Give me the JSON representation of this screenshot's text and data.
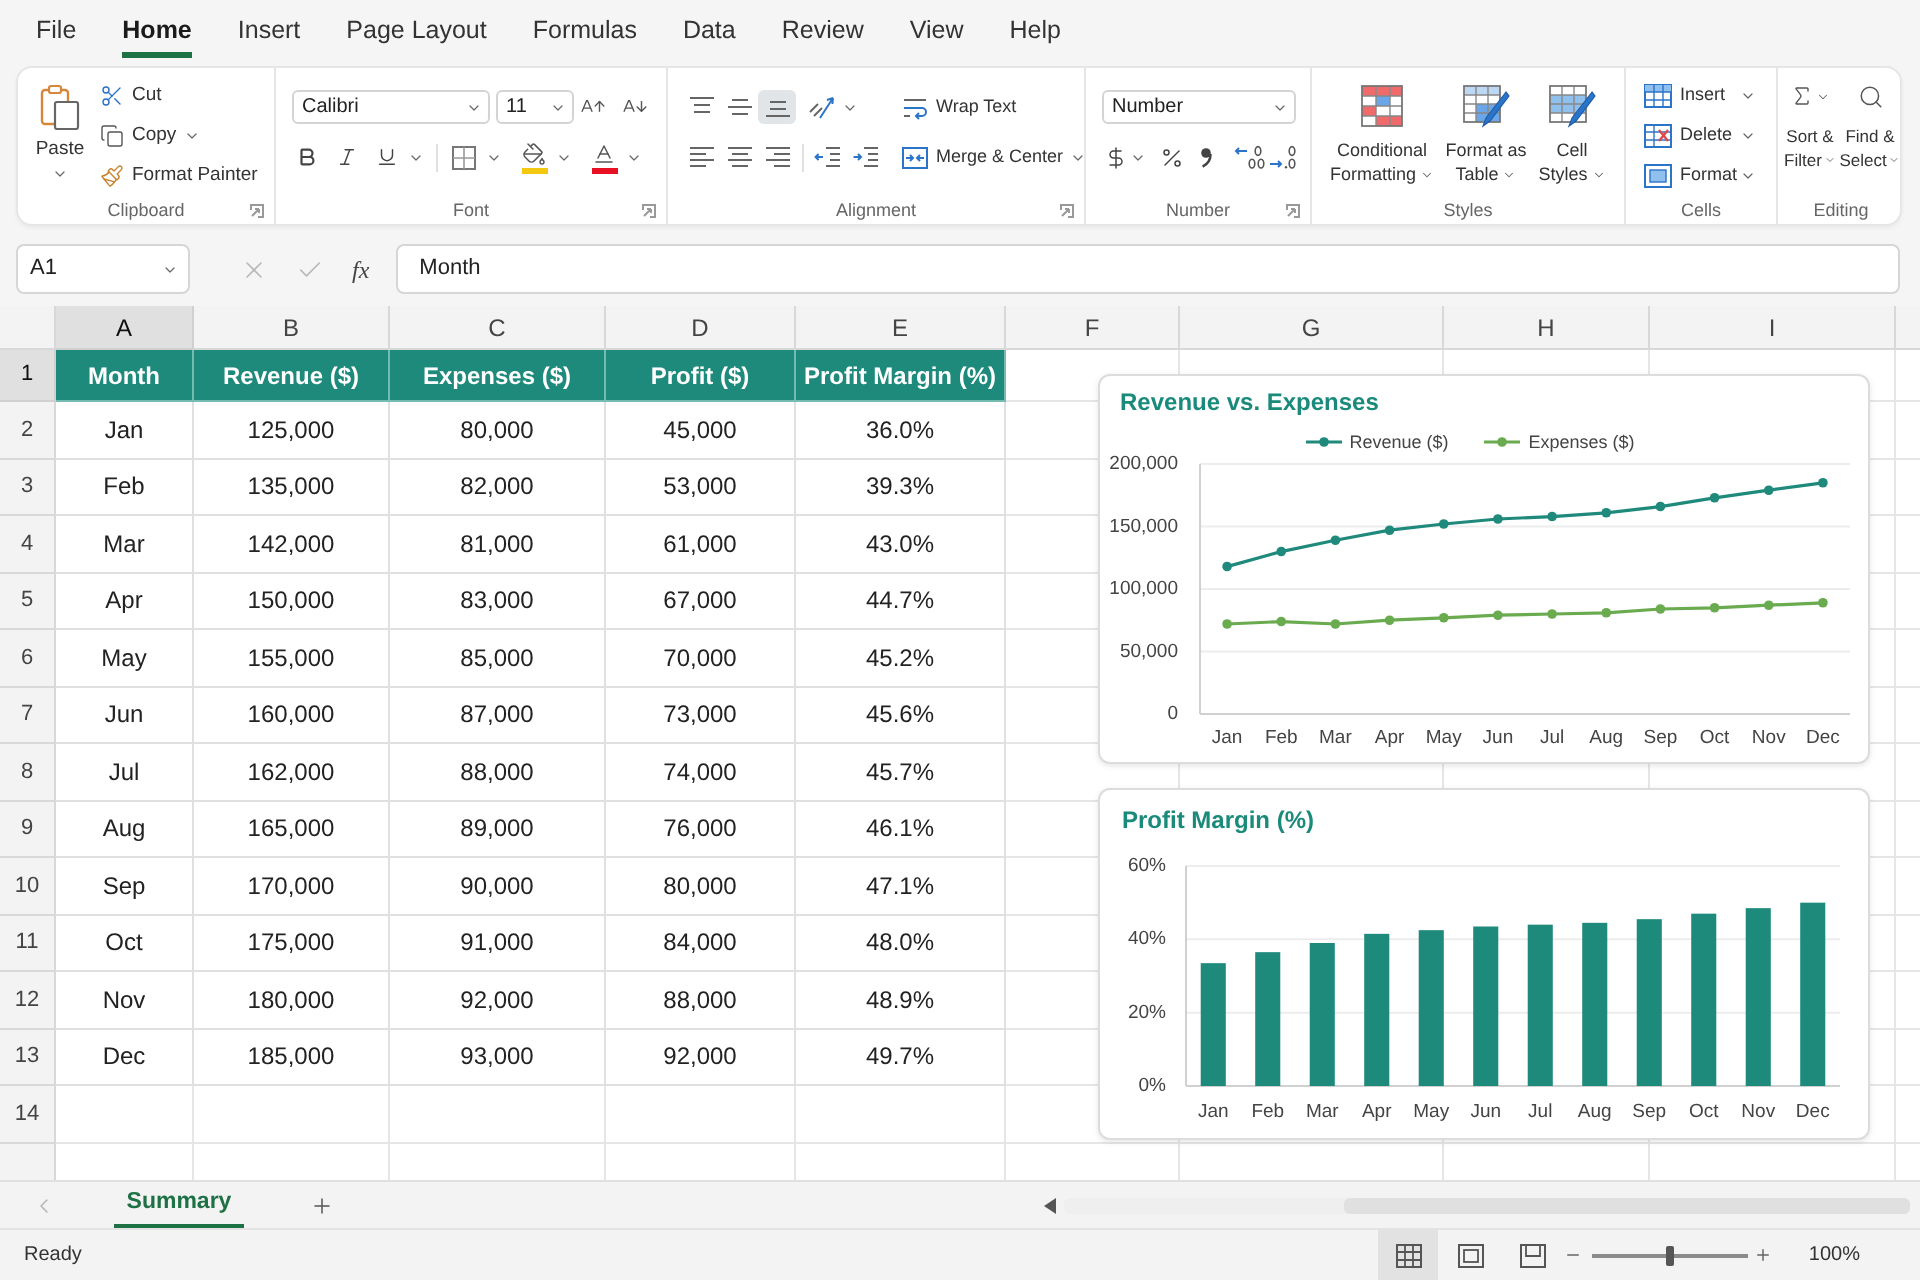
{
  "menu_tabs": [
    {
      "label": "File",
      "selected": false
    },
    {
      "label": "Home",
      "selected": true
    },
    {
      "label": "Insert",
      "selected": false
    },
    {
      "label": "Page Layout",
      "selected": false
    },
    {
      "label": "Formulas",
      "selected": false
    },
    {
      "label": "Data",
      "selected": false
    },
    {
      "label": "Review",
      "selected": false
    },
    {
      "label": "View",
      "selected": false
    },
    {
      "label": "Help",
      "selected": false
    }
  ],
  "ribbon": {
    "clipboard": {
      "label": "Clipboard",
      "paste": "Paste",
      "cut": "Cut",
      "copy": "Copy",
      "format_painter": "Format Painter"
    },
    "font": {
      "label": "Font",
      "font_name": "Calibri",
      "font_size": "11"
    },
    "alignment": {
      "label": "Alignment",
      "vertical": [
        {
          "kind": "top",
          "selected": false
        },
        {
          "kind": "middle",
          "selected": false
        },
        {
          "kind": "bottom",
          "selected": true
        }
      ],
      "wrap_text": "Wrap Text",
      "merge_center": "Merge & Center"
    },
    "number": {
      "label": "Number",
      "format": "Number"
    },
    "styles": {
      "label": "Styles",
      "buttons": [
        {
          "kind": "conditional",
          "lines": [
            "Conditional",
            "Formatting"
          ]
        },
        {
          "kind": "table",
          "lines": [
            "Format as",
            "Table"
          ]
        },
        {
          "kind": "cell_styles",
          "lines": [
            "Cell",
            "Styles"
          ]
        }
      ]
    },
    "cells": {
      "label": "Cells",
      "buttons": [
        {
          "kind": "insert",
          "label": "Insert"
        },
        {
          "kind": "delete",
          "label": "Delete"
        },
        {
          "kind": "format",
          "label": "Format"
        }
      ]
    },
    "editing": {
      "label": "Editing",
      "sort_filter": [
        "Sort &",
        "Filter"
      ],
      "find_select": [
        "Find &",
        "Select"
      ]
    }
  },
  "formula_bar": {
    "name_box": "A1",
    "function_label": "fx",
    "value": "Month"
  },
  "column_headers": [
    {
      "label": "A",
      "selected": true
    },
    {
      "label": "B",
      "selected": false
    },
    {
      "label": "C",
      "selected": false
    },
    {
      "label": "D",
      "selected": false
    },
    {
      "label": "E",
      "selected": false
    },
    {
      "label": "F",
      "selected": false
    },
    {
      "label": "G",
      "selected": false
    },
    {
      "label": "H",
      "selected": false
    },
    {
      "label": "I",
      "selected": false
    }
  ],
  "row_headers": [
    {
      "label": "1",
      "selected": true
    },
    {
      "label": "2",
      "selected": false
    },
    {
      "label": "3",
      "selected": false
    },
    {
      "label": "4",
      "selected": false
    },
    {
      "label": "5",
      "selected": false
    },
    {
      "label": "6",
      "selected": false
    },
    {
      "label": "7",
      "selected": false
    },
    {
      "label": "8",
      "selected": false
    },
    {
      "label": "9",
      "selected": false
    },
    {
      "label": "10",
      "selected": false
    },
    {
      "label": "11",
      "selected": false
    },
    {
      "label": "12",
      "selected": false
    },
    {
      "label": "13",
      "selected": false
    },
    {
      "label": "14",
      "selected": false
    }
  ],
  "table": {
    "columns": [
      "Month",
      "Revenue ($)",
      "Expenses ($)",
      "Profit ($)",
      "Profit Margin (%)"
    ],
    "rows": [
      [
        "Jan",
        "125,000",
        "80,000",
        "45,000",
        "36.0%"
      ],
      [
        "Feb",
        "135,000",
        "82,000",
        "53,000",
        "39.3%"
      ],
      [
        "Mar",
        "142,000",
        "81,000",
        "61,000",
        "43.0%"
      ],
      [
        "Apr",
        "150,000",
        "83,000",
        "67,000",
        "44.7%"
      ],
      [
        "May",
        "155,000",
        "85,000",
        "70,000",
        "45.2%"
      ],
      [
        "Jun",
        "160,000",
        "87,000",
        "73,000",
        "45.6%"
      ],
      [
        "Jul",
        "162,000",
        "88,000",
        "74,000",
        "45.7%"
      ],
      [
        "Aug",
        "165,000",
        "89,000",
        "76,000",
        "46.1%"
      ],
      [
        "Sep",
        "170,000",
        "90,000",
        "80,000",
        "47.1%"
      ],
      [
        "Oct",
        "175,000",
        "91,000",
        "84,000",
        "48.0%"
      ],
      [
        "Nov",
        "180,000",
        "92,000",
        "88,000",
        "48.9%"
      ],
      [
        "Dec",
        "185,000",
        "93,000",
        "92,000",
        "49.7%"
      ]
    ]
  },
  "charts": [
    {
      "chart_data": {
        "type": "line",
        "title": "Revenue vs. Expenses",
        "categories": [
          "Jan",
          "Feb",
          "Mar",
          "Apr",
          "May",
          "Jun",
          "Jul",
          "Aug",
          "Sep",
          "Oct",
          "Nov",
          "Dec"
        ],
        "series": [
          {
            "name": "Revenue ($)",
            "color": "#1f8a7c",
            "marker": "circle",
            "values": [
              118000,
              130000,
              139000,
              147000,
              152000,
              156000,
              158000,
              161000,
              166000,
              173000,
              179000,
              185000
            ]
          },
          {
            "name": "Expenses ($)",
            "color": "#6aab4f",
            "marker": "circle",
            "values": [
              72000,
              74000,
              72000,
              75000,
              77000,
              79000,
              80000,
              81000,
              84000,
              85000,
              87000,
              89000
            ]
          }
        ],
        "ylim": [
          0,
          200000
        ],
        "yticks": [
          {
            "value": 200000,
            "label": "200,000"
          },
          {
            "value": 150000,
            "label": "150,000"
          },
          {
            "value": 100000,
            "label": "100,000"
          },
          {
            "value": 50000,
            "label": "50,000"
          },
          {
            "value": 0,
            "label": "0"
          }
        ],
        "grid": true,
        "legend": true
      }
    },
    {
      "chart_data": {
        "type": "bar",
        "title": "Profit Margin (%)",
        "categories": [
          "Jan",
          "Feb",
          "Mar",
          "Apr",
          "May",
          "Jun",
          "Jul",
          "Aug",
          "Sep",
          "Oct",
          "Nov",
          "Dec"
        ],
        "values": [
          33.5,
          36.5,
          39,
          41.5,
          42.5,
          43.5,
          44,
          44.5,
          45.5,
          47,
          48.5,
          50
        ],
        "ylim": [
          0,
          60
        ],
        "yticks": [
          {
            "value": 60,
            "label": "60%"
          },
          {
            "value": 40,
            "label": "40%"
          },
          {
            "value": 20,
            "label": "20%"
          },
          {
            "value": 0,
            "label": "0%"
          }
        ],
        "grid": true
      }
    }
  ],
  "sheet_tabs": [
    {
      "label": "Summary",
      "selected": true
    }
  ],
  "status_bar": {
    "status": "Ready",
    "views": [
      {
        "kind": "normal",
        "selected": true
      },
      {
        "kind": "page_layout",
        "selected": false
      },
      {
        "kind": "page_break",
        "selected": false
      }
    ],
    "zoom": {
      "level": 0.5,
      "reading": "100%"
    }
  }
}
